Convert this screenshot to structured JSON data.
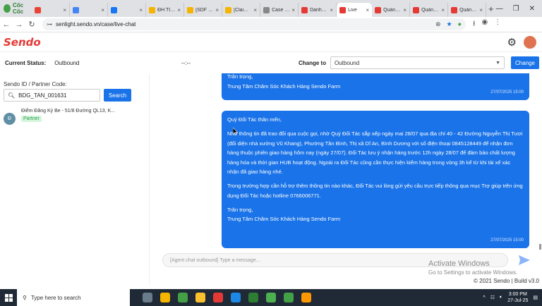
{
  "browser": {
    "logo_text": "Cốc Cốc",
    "tabs": [
      {
        "label": "",
        "color": "#ea4335"
      },
      {
        "label": "",
        "color": "#4285f4"
      },
      {
        "label": "",
        "color": "#1877f2"
      },
      {
        "label": "ĐH TIKTO",
        "color": "#f4b400"
      },
      {
        "label": "[SDF Cup",
        "color": "#f4b400"
      },
      {
        "label": "[Claim &",
        "color": "#f4b400"
      },
      {
        "label": "Case syst",
        "color": "#888888"
      },
      {
        "label": "Danh sác",
        "color": "#e53935"
      },
      {
        "label": "Live",
        "color": "#e53935",
        "active": true
      },
      {
        "label": "Quản Lý",
        "color": "#e53935"
      },
      {
        "label": "Quản Lý",
        "color": "#e53935"
      },
      {
        "label": "Quản Lý",
        "color": "#e53935"
      }
    ],
    "url": "senlight.sendo.vn/case/live-chat"
  },
  "app": {
    "brand": "Sendo",
    "settings_icon": "gear-icon"
  },
  "status": {
    "label": "Current Status:",
    "value": "Outbound",
    "timer": "--:--",
    "change_label": "Change to",
    "selected": "Outbound",
    "change_button": "Change"
  },
  "left": {
    "field_label": "Sendo ID / Partner Code:",
    "search_value": "BDG_TAN_001631",
    "search_button": "Search",
    "contact": {
      "initial": "Đ",
      "name": "Điểm Đăng Ký Be - 51/8 Đường QL13, K...",
      "badge": "Partner"
    }
  },
  "chat": {
    "bubble1": {
      "line1": "Trân trọng,",
      "line2": "Trung Tâm Chăm Sóc Khách Hàng Sendo Farm",
      "time": "27/07/2025 15:00"
    },
    "bubble2": {
      "greeting": "Quý Đối Tác thân mến,",
      "para1": "Như thông tin đã trao đổi qua cuộc gọi, nhờ Quý Đối Tác sắp xếp ngày mai 28/07 qua địa chỉ 40 - 42 Đường Nguyễn Thị Tươi (đối diện nhà xưởng Vũ Khang), Phường Tân Bình, Thị xã Dĩ An, Bình Dương với số điện thoại 0845128449 để nhận đơn hàng thuộc phiên giao hàng hôm nay (ngày 27/07). Đối Tác lưu ý nhận hàng trước 12h ngày 28/07 để đảm bảo chất lượng hàng hóa và thời gian HUB hoạt động. Ngoài ra Đối Tác cũng cần thực hiện kiểm hàng trong vòng 3h kể từ khi tài xế xác nhận đã giao hàng nhé.",
      "para2": "Trong trường hợp cần hỗ trợ thêm thông tin nào khác, Đối Tác vui lòng gửi yêu cầu trực tiếp thông qua mục Trợ giúp trên ứng dụng Đối Tác hoặc hotline 0766006771.",
      "sign1": "Trân trọng,",
      "sign2": "Trung Tâm Chăm Sóc Khách Hàng Sendo Farm",
      "time": "27/07/2025 15:00"
    },
    "input_placeholder": "[Agent chat outbound] Type a message...",
    "send_icon": "send-icon"
  },
  "watermark": {
    "title": "Activate Windows",
    "subtitle": "Go to Settings to activate Windows."
  },
  "footer": "© 2021 Sendo | Build v3.0",
  "taskbar": {
    "search_placeholder": "Type here to search",
    "time": "3:00 PM",
    "date": "27-Jul-25",
    "apps": [
      "#6a7b8c",
      "#f4b400",
      "#43a047",
      "#fbc02d",
      "#e53935",
      "#1e88e5",
      "#2e7d32",
      "#4caf50",
      "#43a047",
      "#ff9800"
    ]
  }
}
